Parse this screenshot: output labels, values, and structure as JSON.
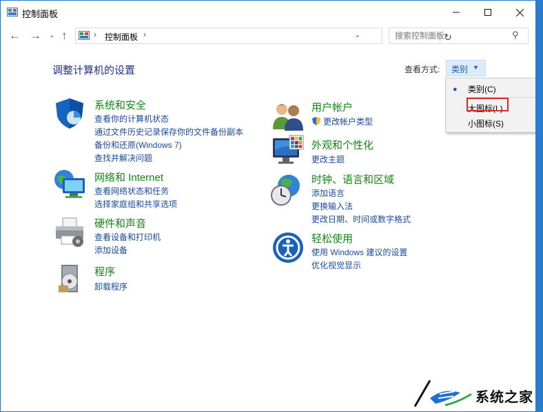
{
  "window": {
    "title": "控制面板"
  },
  "address": {
    "path": "控制面板"
  },
  "search": {
    "placeholder": "搜索控制面板"
  },
  "page": {
    "title": "调整计算机的设置"
  },
  "view_by": {
    "label": "查看方式:",
    "value": "类别"
  },
  "view_menu": {
    "items": [
      {
        "label": "类别(C)",
        "selected": true
      },
      {
        "label": "大图标(L)",
        "selected": false,
        "highlighted": true
      },
      {
        "label": "小图标(S)",
        "selected": false
      }
    ]
  },
  "categories": {
    "system_security": {
      "title": "系统和安全",
      "links": [
        "查看你的计算机状态",
        "通过文件历史记录保存你的文件备份副本",
        "备份和还原(Windows 7)",
        "查找并解决问题"
      ],
      "icon": "shield-icon"
    },
    "network": {
      "title": "网络和 Internet",
      "links": [
        "查看网络状态和任务",
        "选择家庭组和共享选项"
      ],
      "icon": "network-globe-icon"
    },
    "hardware": {
      "title": "硬件和声音",
      "links": [
        "查看设备和打印机",
        "添加设备"
      ],
      "icon": "printer-icon"
    },
    "programs": {
      "title": "程序",
      "links": [
        "卸载程序"
      ],
      "icon": "programs-disc-icon"
    },
    "user_accounts": {
      "title": "用户帐户",
      "links": [
        "更改帐户类型"
      ],
      "icon": "users-icon"
    },
    "appearance": {
      "title": "外观和个性化",
      "links": [
        "更改主题"
      ],
      "icon": "monitor-palette-icon"
    },
    "clock_region": {
      "title": "时钟、语言和区域",
      "links": [
        "添加语言",
        "更换输入法",
        "更改日期、时间或数字格式"
      ],
      "icon": "clock-globe-icon"
    },
    "ease_of_access": {
      "title": "轻松使用",
      "links": [
        "使用 Windows 建议的设置",
        "优化视觉显示"
      ],
      "icon": "accessibility-icon"
    }
  },
  "watermark": {
    "text": "系统之家"
  },
  "colors": {
    "category_title": "#118811",
    "link": "#1a4aa0",
    "page_title": "#1e3287",
    "accent": "#1979ca"
  }
}
